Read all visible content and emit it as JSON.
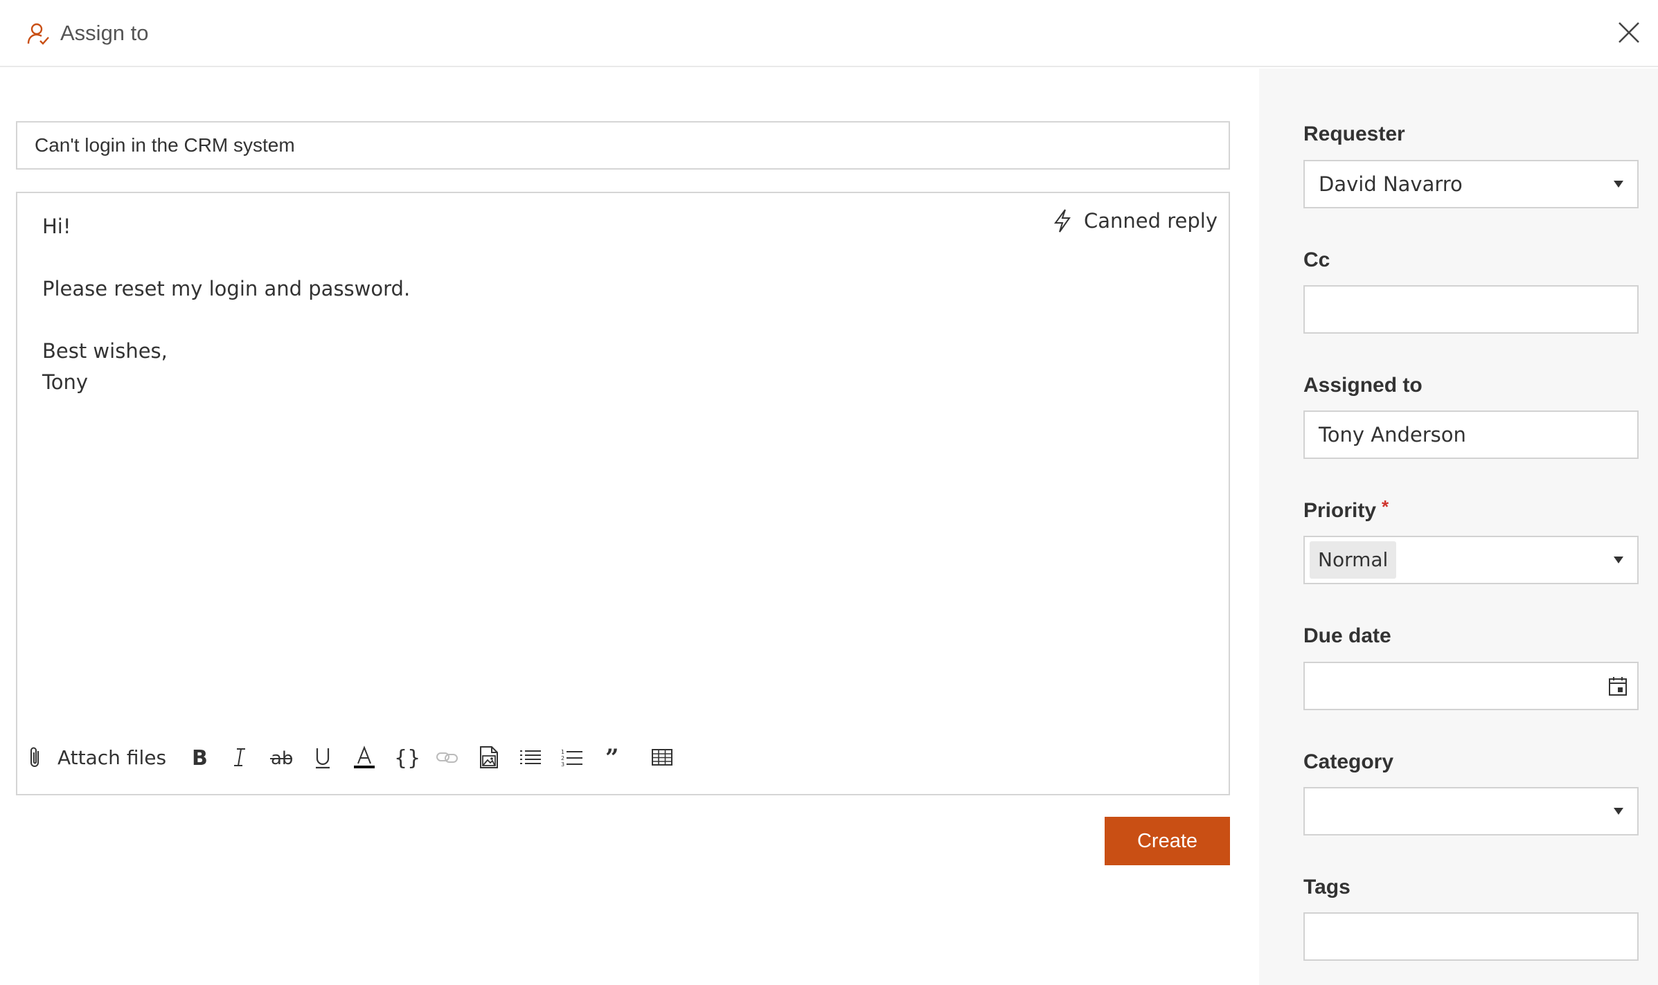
{
  "header": {
    "icon": "user-assign-icon",
    "title": "Assign to",
    "close_icon": "close-icon"
  },
  "compose": {
    "subject": "Can't login in the CRM system",
    "canned_reply": "Canned reply",
    "body_lines": [
      "Hi!",
      "",
      "Please reset my login and password.",
      "",
      "Best wishes,",
      "Tony"
    ],
    "toolbar": {
      "attach_label": "Attach files",
      "tools": [
        "bold-icon",
        "italic-icon",
        "strikethrough-icon",
        "underline-icon",
        "font-color-icon",
        "code-icon",
        "link-icon",
        "image-icon",
        "bulleted-list-icon",
        "numbered-list-icon",
        "quote-icon",
        "table-icon"
      ]
    },
    "create_label": "Create",
    "accent_color": "#c94f14"
  },
  "side": {
    "requester": {
      "label": "Requester",
      "value": "David Navarro"
    },
    "cc": {
      "label": "Cc",
      "value": ""
    },
    "assigned_to": {
      "label": "Assigned to",
      "value": "Tony Anderson"
    },
    "priority": {
      "label": "Priority",
      "required_mark": "*",
      "value": "Normal"
    },
    "due_date": {
      "label": "Due date",
      "value": ""
    },
    "category": {
      "label": "Category",
      "value": ""
    },
    "tags": {
      "label": "Tags",
      "value": ""
    }
  }
}
